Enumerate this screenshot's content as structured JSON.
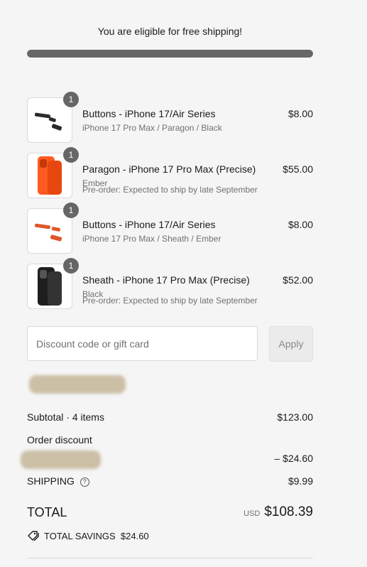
{
  "shipping": {
    "message": "You are eligible for free shipping!",
    "progress_fraction": 1.0
  },
  "items": [
    {
      "quantity": "1",
      "title": "Buttons - iPhone 17/Air Series",
      "variant": "iPhone 17 Pro Max / Paragon / Black",
      "note": "",
      "price": "$8.00"
    },
    {
      "quantity": "1",
      "title": "Paragon - iPhone 17 Pro Max (Precise)",
      "variant": "Ember",
      "note": "Pre-order: Expected to ship by late September",
      "price": "$55.00"
    },
    {
      "quantity": "1",
      "title": "Buttons - iPhone 17/Air Series",
      "variant": "iPhone 17 Pro Max / Sheath / Ember",
      "note": "",
      "price": "$8.00"
    },
    {
      "quantity": "1",
      "title": "Sheath - iPhone 17 Pro Max (Precise)",
      "variant": "Black",
      "note": "Pre-order: Expected to ship by late September",
      "price": "$52.00"
    }
  ],
  "discount": {
    "placeholder": "Discount code or gift card",
    "apply_label": "Apply"
  },
  "summary": {
    "subtotal_label": "Subtotal · 4 items",
    "subtotal_value": "$123.00",
    "order_discount_label": "Order discount",
    "order_discount_value": "– $24.60",
    "shipping_label": "SHIPPING",
    "shipping_value": "$9.99",
    "total_label": "TOTAL",
    "total_currency": "USD",
    "total_value": "$108.39",
    "savings_label": "TOTAL SAVINGS",
    "savings_value": "$24.60"
  },
  "colors": {
    "progress_fill": "#666666",
    "badge": "#666666",
    "redacted": "#cbbfa6"
  }
}
